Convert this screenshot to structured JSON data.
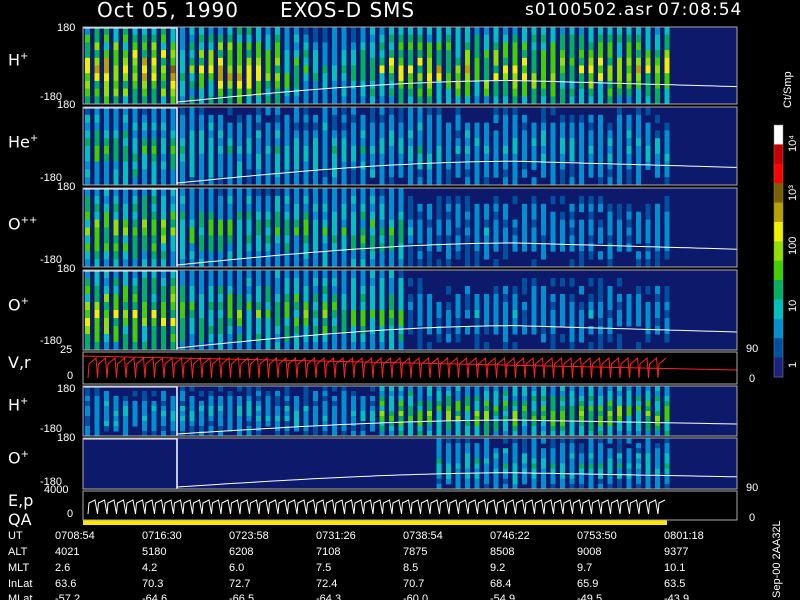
{
  "header": {
    "date": "Oct 05, 1990",
    "instrument": "EXOS-D SMS",
    "file": "s0100502.asr",
    "time": "07:08:54"
  },
  "panels": [
    {
      "label": "H",
      "sup": "+",
      "ytop": "180",
      "ybot": "-180"
    },
    {
      "label": "He",
      "sup": "+",
      "ytop": "180",
      "ybot": "-180"
    },
    {
      "label": "O",
      "sup": "++",
      "ytop": "180",
      "ybot": "-180"
    },
    {
      "label": "O",
      "sup": "+",
      "ytop": "180",
      "ybot": "-180"
    },
    {
      "label": "V,r",
      "sup": "",
      "ytop": "25",
      "ybot": "0"
    },
    {
      "label": "H",
      "sup": "+",
      "ytop": "180",
      "ybot": "-180"
    },
    {
      "label": "O",
      "sup": "+",
      "ytop": "180",
      "ybot": "-180"
    },
    {
      "label": "E,p",
      "sup": "",
      "ytop": "4000",
      "ybot": "0"
    }
  ],
  "qa_label": "QA",
  "right_axis": {
    "vr_top": "90",
    "vr_bot": "0",
    "o_bot": "90",
    "ep_bot": "0"
  },
  "colorbar": {
    "unit": "Ct/Smp",
    "ticks": [
      "10⁴",
      "10³",
      "100",
      "10",
      "1"
    ],
    "colors": [
      "#ffffff",
      "#c80000",
      "#ff0000",
      "#7a6000",
      "#b8a000",
      "#f0f000",
      "#90e000",
      "#40d000",
      "#00b060",
      "#00c0c0",
      "#0090d0",
      "#0050a0",
      "#1a237e"
    ]
  },
  "footer_id": "Sep-00  2AA32L",
  "ephemeris": {
    "rows": [
      {
        "name": "UT",
        "values": [
          "0708:54",
          "0716:30",
          "0723:58",
          "0731:26",
          "0738:54",
          "0746:22",
          "0753:50",
          "0801:18"
        ]
      },
      {
        "name": "ALT",
        "values": [
          "4021",
          "5180",
          "6208",
          "7108",
          "7875",
          "8508",
          "9008",
          "9377"
        ]
      },
      {
        "name": "MLT",
        "values": [
          "2.6",
          "4.2",
          "6.0",
          "7.5",
          "8.5",
          "9.2",
          "9.7",
          "10.1"
        ]
      },
      {
        "name": "InLat",
        "values": [
          "63.6",
          "70.3",
          "72.7",
          "72.4",
          "70.7",
          "68.4",
          "65.9",
          "63.5"
        ]
      },
      {
        "name": "MLat",
        "values": [
          "-57.2",
          "-64.6",
          "-66.5",
          "-64.3",
          "-60.0",
          "-54.9",
          "-49.5",
          "-43.9"
        ]
      }
    ]
  },
  "chart_data": {
    "type": "heatmap",
    "title": "Oct 05, 1990   EXOS-D SMS",
    "x_ticks": [
      "0708:54",
      "0716:30",
      "0723:58",
      "0731:26",
      "0738:54",
      "0746:22",
      "0753:50",
      "0801:18"
    ],
    "colorbar_unit": "Ct/Smp",
    "colorbar_ticks": [
      "1",
      "10",
      "100",
      "10³",
      "10⁴"
    ],
    "panels": [
      "H+",
      "He+",
      "O++",
      "O+",
      "V,r",
      "H+",
      "O+",
      "E,p"
    ],
    "ylim": [
      -180,
      180
    ],
    "grid": false
  }
}
